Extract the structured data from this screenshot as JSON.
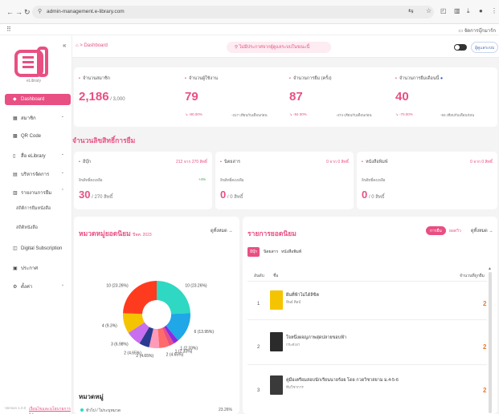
{
  "browser": {
    "url": "admin-management.e-library.com",
    "bookmarks_label": "จัดการบุ๊กมาร์ก"
  },
  "sidebar": {
    "logo_text": "eLibrary",
    "items": [
      {
        "label": "Dashboard",
        "icon": "diamond-icon",
        "active": true
      },
      {
        "label": "สมาชิก",
        "icon": "users-icon"
      },
      {
        "label": "QR Code",
        "icon": "qr-icon"
      },
      {
        "label": "สื่อ eLibrary",
        "icon": "book-icon"
      },
      {
        "label": "บริหารจัดการ",
        "icon": "document-icon"
      },
      {
        "label": "รายงานการยืม",
        "icon": "report-icon"
      }
    ],
    "submenu": [
      "สถิติการยืมหนังสือ",
      "สถิติหนังสือ"
    ],
    "items2": [
      {
        "label": "Digital Subscription",
        "icon": "subscription-icon"
      },
      {
        "label": "ประกาศ",
        "icon": "announce-icon"
      },
      {
        "label": "ตั้งค่า",
        "icon": "settings-icon"
      }
    ],
    "version": "Version 1.0.0",
    "footer_link": "เงื่อนไขและนโยบายการใช้งาน"
  },
  "header": {
    "breadcrumb": "Dashboard",
    "notice": "ไม่มีประกาศจากผู้ดูแลระบบในขณะนี้",
    "user_btn": "ผู้ดูแลระบบ"
  },
  "stats": [
    {
      "title": "จำนวนสมาชิก",
      "value": "2,186",
      "suffix": " / 3,000",
      "sub": "",
      "sub2": ""
    },
    {
      "title": "จำนวนผู้ใช้งาน",
      "value": "79",
      "suffix": "",
      "sub": "↘ -80.00%",
      "sub2": "-317 เทียบกับเดือนก่อน"
    },
    {
      "title": "จำนวนการยืม (ครั้ง)",
      "value": "87",
      "suffix": "",
      "sub": "↘ -84.00%",
      "sub2": "-474 เทียบกับเดือนก่อน"
    },
    {
      "title": "จำนวนการยืมเดือนนี้",
      "value": "40",
      "suffix": "",
      "sub": "↘ -70.00%",
      "sub2": "-93 เทียบกับเดือนก่อน"
    }
  ],
  "section_title": "จำนวนลิขสิทธิ์การยืม",
  "categories": [
    {
      "title": "อีบุ๊ก",
      "right": "212 จาก 270 สิทธิ์",
      "label": "ลิขสิทธิ์คงเหลือ",
      "pct": "+4%",
      "value": "30",
      "suffix": " / 270 สิทธิ์"
    },
    {
      "title": "นิตยสาร",
      "right": "0 จาก 0 สิทธิ์",
      "label": "ลิขสิทธิ์คงเหลือ",
      "pct": "",
      "value": "0",
      "suffix": " / 0 สิทธิ์"
    },
    {
      "title": "หนังสือพิมพ์",
      "right": "0 จาก 0 สิทธิ์",
      "label": "ลิขสิทธิ์คงเหลือ",
      "pct": "",
      "value": "0",
      "suffix": " / 0 สิทธิ์"
    }
  ],
  "popular_categories": {
    "title": "หมวดหมู่ยอดนิยม",
    "period": "ปีพศ. 2023",
    "link": "ดูทั้งหมด →",
    "legend_title": "หมวดหมู่",
    "legend": [
      {
        "name": "ทั่วไป / ไม่ระบุหมวด",
        "pct": "23.26%",
        "color": "#2ed8c3"
      }
    ]
  },
  "chart_data": {
    "type": "pie",
    "slices": [
      {
        "label": "10 (23.26%)",
        "value": 10,
        "color": "#2ed8c3"
      },
      {
        "label": "6 (13.95%)",
        "value": 6,
        "color": "#1fa7e8"
      },
      {
        "label": "1 (2.33%)",
        "value": 1,
        "color": "#8a2be2"
      },
      {
        "label": "1 (2.33%)",
        "value": 1,
        "color": "#e84f82"
      },
      {
        "label": "2 (4.65%)",
        "value": 2,
        "color": "#ff6a6a"
      },
      {
        "label": "2 (4.65%)",
        "value": 2,
        "color": "#ff9ab8"
      },
      {
        "label": "2 (4.65%)",
        "value": 2,
        "color": "#2a3b8f"
      },
      {
        "label": "3 (6.98%)",
        "value": 3,
        "color": "#c86ef0"
      },
      {
        "label": "4 (9.3%)",
        "value": 4,
        "color": "#f5c400"
      },
      {
        "label": "10 (23.26%)",
        "value": 10,
        "color": "#ff3b1f"
      }
    ]
  },
  "popular_books": {
    "title": "รายการยอดนิยม",
    "tabs": [
      {
        "label": "การยืม",
        "on": true
      },
      {
        "label": "ยอดวิว",
        "on": false
      }
    ],
    "link": "ดูทั้งหมด →",
    "subtabs": [
      "อีบุ๊ก",
      "นิตยสาร",
      "หนังสือพิมพ์"
    ],
    "columns": [
      "อันดับ",
      "ชื่อ",
      "จำนวนที่ถูกยืม"
    ],
    "rows": [
      {
        "rank": "1",
        "title": "ฝันที่ฟ้าไม่ได้ลิขิต",
        "author": "ทิพย์ ศิลป์",
        "count": "2",
        "cover": "#f5c400"
      },
      {
        "rank": "2",
        "title": "ใจหนึ่งผจญภาพสุดปลายขอบฟ้า",
        "author": "กระดังงา",
        "count": "2",
        "cover": "#2b2b2b"
      },
      {
        "rank": "3",
        "title": "คู่มือเตรียมสอบนักเรียนนายร้อย โดย กวดวิชาสยาม ม.4-5-6",
        "author": "ทีมวิชาการ",
        "count": "2",
        "cover": "#3a3a3a"
      }
    ]
  }
}
